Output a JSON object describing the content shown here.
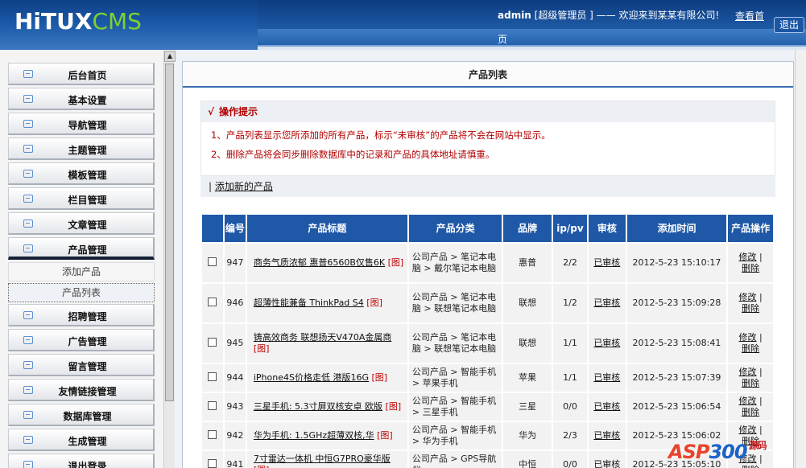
{
  "header": {
    "logo_main": "HiTUX",
    "logo_sub": "CMS",
    "welcome_user": "admin",
    "welcome_rest": " [超级管理员 ] —— 欢迎来到某某有限公司!",
    "home_link": "查看首",
    "home_link_wrap": "页",
    "logout": "退出"
  },
  "sidebar": {
    "items": [
      {
        "label": "后台首页"
      },
      {
        "label": "基本设置"
      },
      {
        "label": "导航管理"
      },
      {
        "label": "主题管理"
      },
      {
        "label": "模板管理"
      },
      {
        "label": "栏目管理"
      },
      {
        "label": "文章管理"
      },
      {
        "label": "产品管理"
      }
    ],
    "sub_items": [
      {
        "label": "添加产品"
      },
      {
        "label": "产品列表"
      }
    ],
    "items_after": [
      {
        "label": "招聘管理"
      },
      {
        "label": "广告管理"
      },
      {
        "label": "留言管理"
      },
      {
        "label": "友情链接管理"
      },
      {
        "label": "数据库管理"
      },
      {
        "label": "生成管理"
      },
      {
        "label": "退出登录"
      }
    ]
  },
  "main": {
    "title": "产品列表",
    "tips_title": "操作提示",
    "tips_check": "√",
    "tip1": "1、产品列表显示您所添加的所有产品，标示“未审核”的产品将不会在网站中显示。",
    "tip2": "2、删除产品将会同步删除数据库中的记录和产品的具体地址请慎重。",
    "add_link": "添加新的产品",
    "add_sep": "|"
  },
  "table": {
    "headers": [
      "",
      "编号",
      "产品标题",
      "产品分类",
      "品牌",
      "ip/pv",
      "审核",
      "添加时间",
      "产品操作"
    ],
    "img_tag": "[图]",
    "edit": "修改",
    "del": "删除",
    "op_sep": "|",
    "rows": [
      {
        "id": "947",
        "title": "商务气质浓郁 惠普6560B仅售6K",
        "cat": "公司产品 > 笔记本电脑 > 戴尔笔记本电脑",
        "brand": "惠普",
        "ippv": "2/2",
        "status": "已审核",
        "time": "2012-5-23 15:10:17"
      },
      {
        "id": "946",
        "title": "超薄性能兼备 ThinkPad S4",
        "cat": "公司产品 > 笔记本电脑 > 联想笔记本电脑",
        "brand": "联想",
        "ippv": "1/2",
        "status": "已审核",
        "time": "2012-5-23 15:09:28"
      },
      {
        "id": "945",
        "title": "铸高效商务 联想扬天V470A金属商",
        "cat": "公司产品 > 笔记本电脑 > 联想笔记本电脑",
        "brand": "联想",
        "ippv": "1/1",
        "status": "已审核",
        "time": "2012-5-23 15:08:41"
      },
      {
        "id": "944",
        "title": "iPhone4S价格走低 港版16G",
        "cat": "公司产品 > 智能手机 > 苹果手机",
        "brand": "苹果",
        "ippv": "1/1",
        "status": "已审核",
        "time": "2012-5-23 15:07:39"
      },
      {
        "id": "943",
        "title": "三星手机: 5.3寸屏双核安卓 欧版",
        "cat": "公司产品 > 智能手机 > 三星手机",
        "brand": "三星",
        "ippv": "0/0",
        "status": "已审核",
        "time": "2012-5-23 15:06:54"
      },
      {
        "id": "942",
        "title": "华为手机: 1.5GHz超薄双核,华",
        "cat": "公司产品 > 智能手机 > 华为手机",
        "brand": "华为",
        "ippv": "2/3",
        "status": "已审核",
        "time": "2012-5-23 15:06:02"
      },
      {
        "id": "941",
        "title": "7寸雷达一体机 中恒G7PRO豪华版",
        "cat": "公司产品 > GPS导航仪 > ",
        "brand": "中恒",
        "ippv": "0/0",
        "status": "已审核",
        "time": "2012-5-23 15:05:10"
      }
    ]
  },
  "watermark": {
    "a": "ASP",
    "b": "300",
    "c": "源码"
  }
}
